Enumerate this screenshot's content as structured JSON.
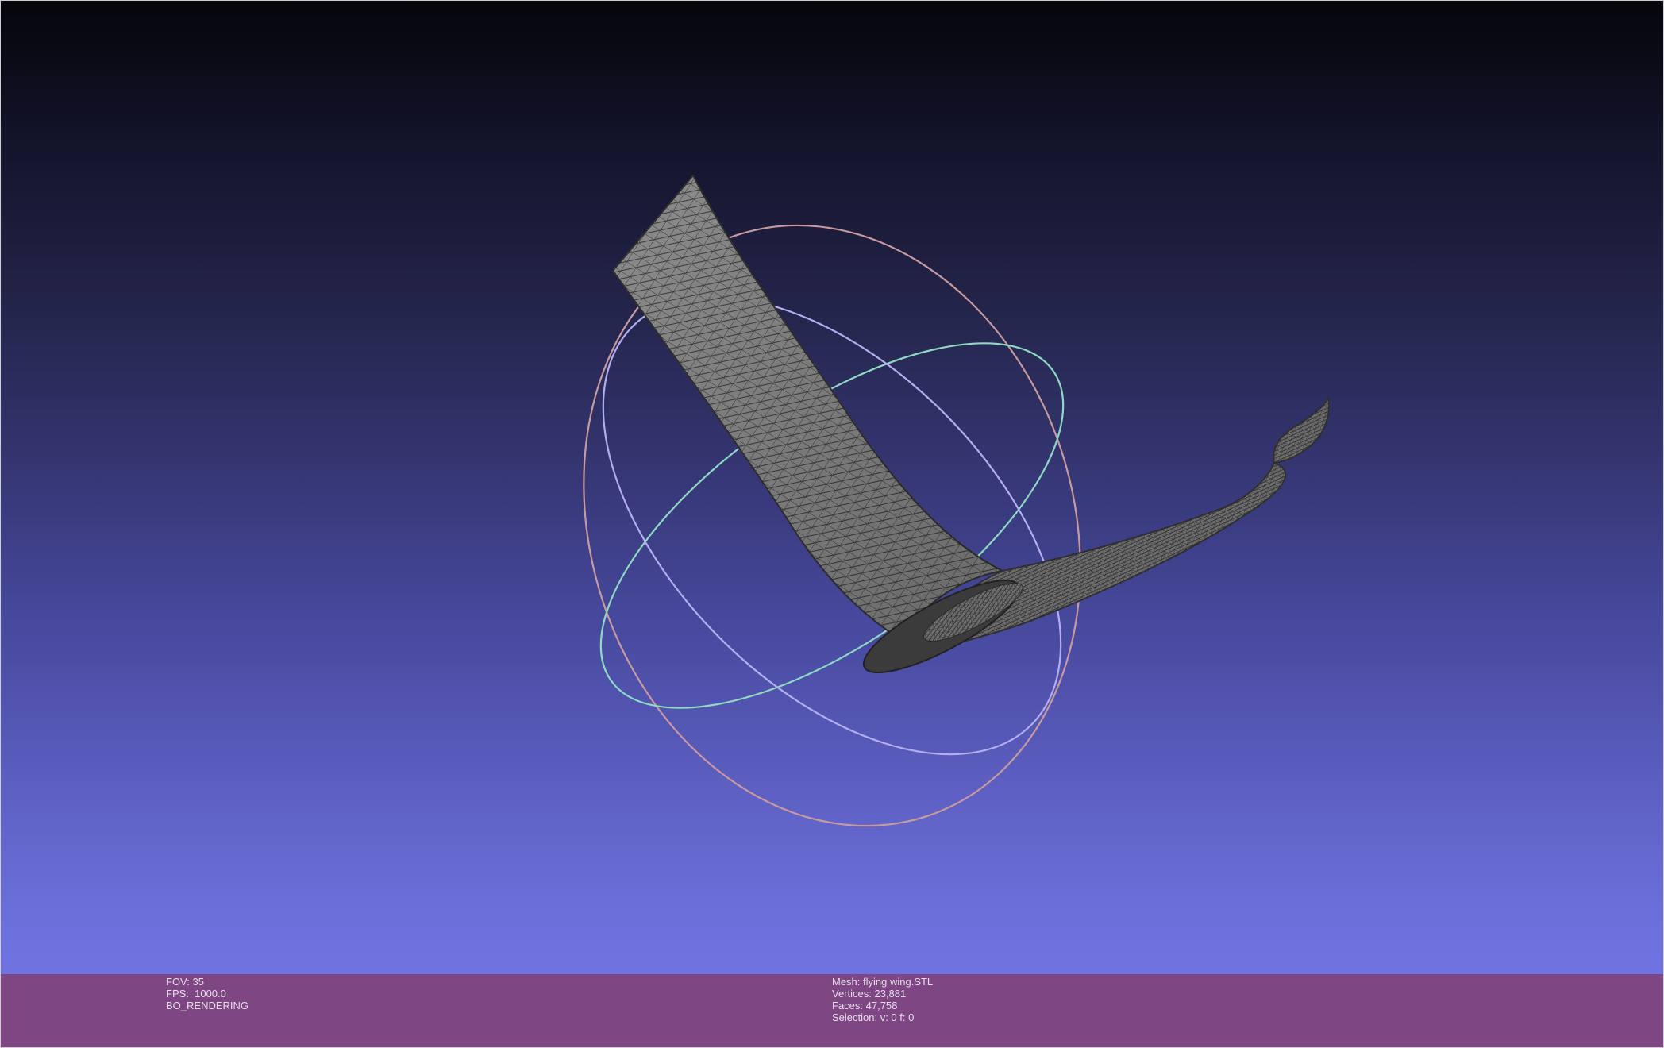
{
  "viewer": {
    "background_top": "#05050a",
    "background_bottom": "#7577ea",
    "info_bar_color": "#7e4683",
    "mesh_color": "#808080",
    "wire_color": "#2a2a2a",
    "trackball_colors": {
      "ring_vertical": "#d89a9a",
      "ring_horizontal": "#8fe0c6",
      "ring_diagonal": "#b7b0f3"
    }
  },
  "left_info": {
    "fov": "FOV: 35",
    "fps": "FPS:  1000.0",
    "mode": "BO_RENDERING"
  },
  "mesh_info": {
    "mesh": "Mesh: flying wing.STL",
    "vertices": "Vertices: 23,881",
    "faces": "Faces: 47,758",
    "selection": "Selection: v: 0 f: 0"
  }
}
